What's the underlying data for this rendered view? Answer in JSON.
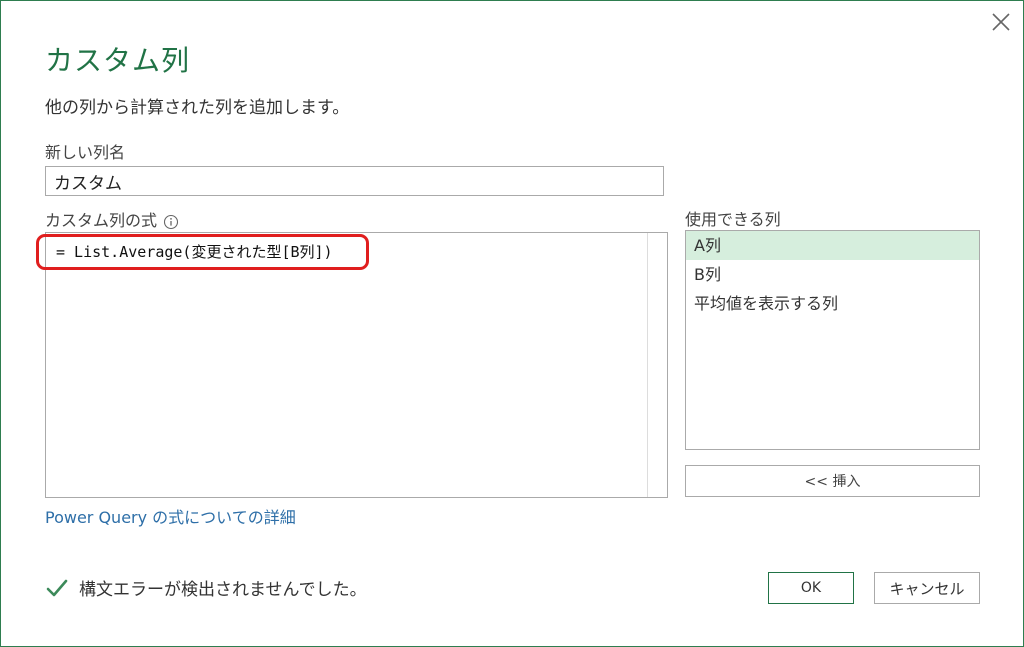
{
  "dialog": {
    "title": "カスタム列",
    "subtitle": "他の列から計算された列を追加します。",
    "accent_color": "#217346",
    "highlight_color": "#e01e1e"
  },
  "new_column": {
    "label": "新しい列名",
    "value": "カスタム"
  },
  "formula": {
    "label": "カスタム列の式",
    "info_icon": "info-icon",
    "value": "= List.Average(変更された型[B列])"
  },
  "available_columns": {
    "label": "使用できる列",
    "items": [
      {
        "label": "A列",
        "selected": true
      },
      {
        "label": "B列",
        "selected": false
      },
      {
        "label": "平均値を表示する列",
        "selected": false
      }
    ],
    "selected_color": "#d6eedd"
  },
  "buttons": {
    "insert": "<< 挿入",
    "ok": "OK",
    "cancel": "キャンセル",
    "close_icon": "close-icon"
  },
  "help_link": "Power Query の式についての詳細",
  "status": {
    "icon": "checkmark-icon",
    "text": "構文エラーが検出されませんでした。",
    "color": "#3c8a5a"
  }
}
